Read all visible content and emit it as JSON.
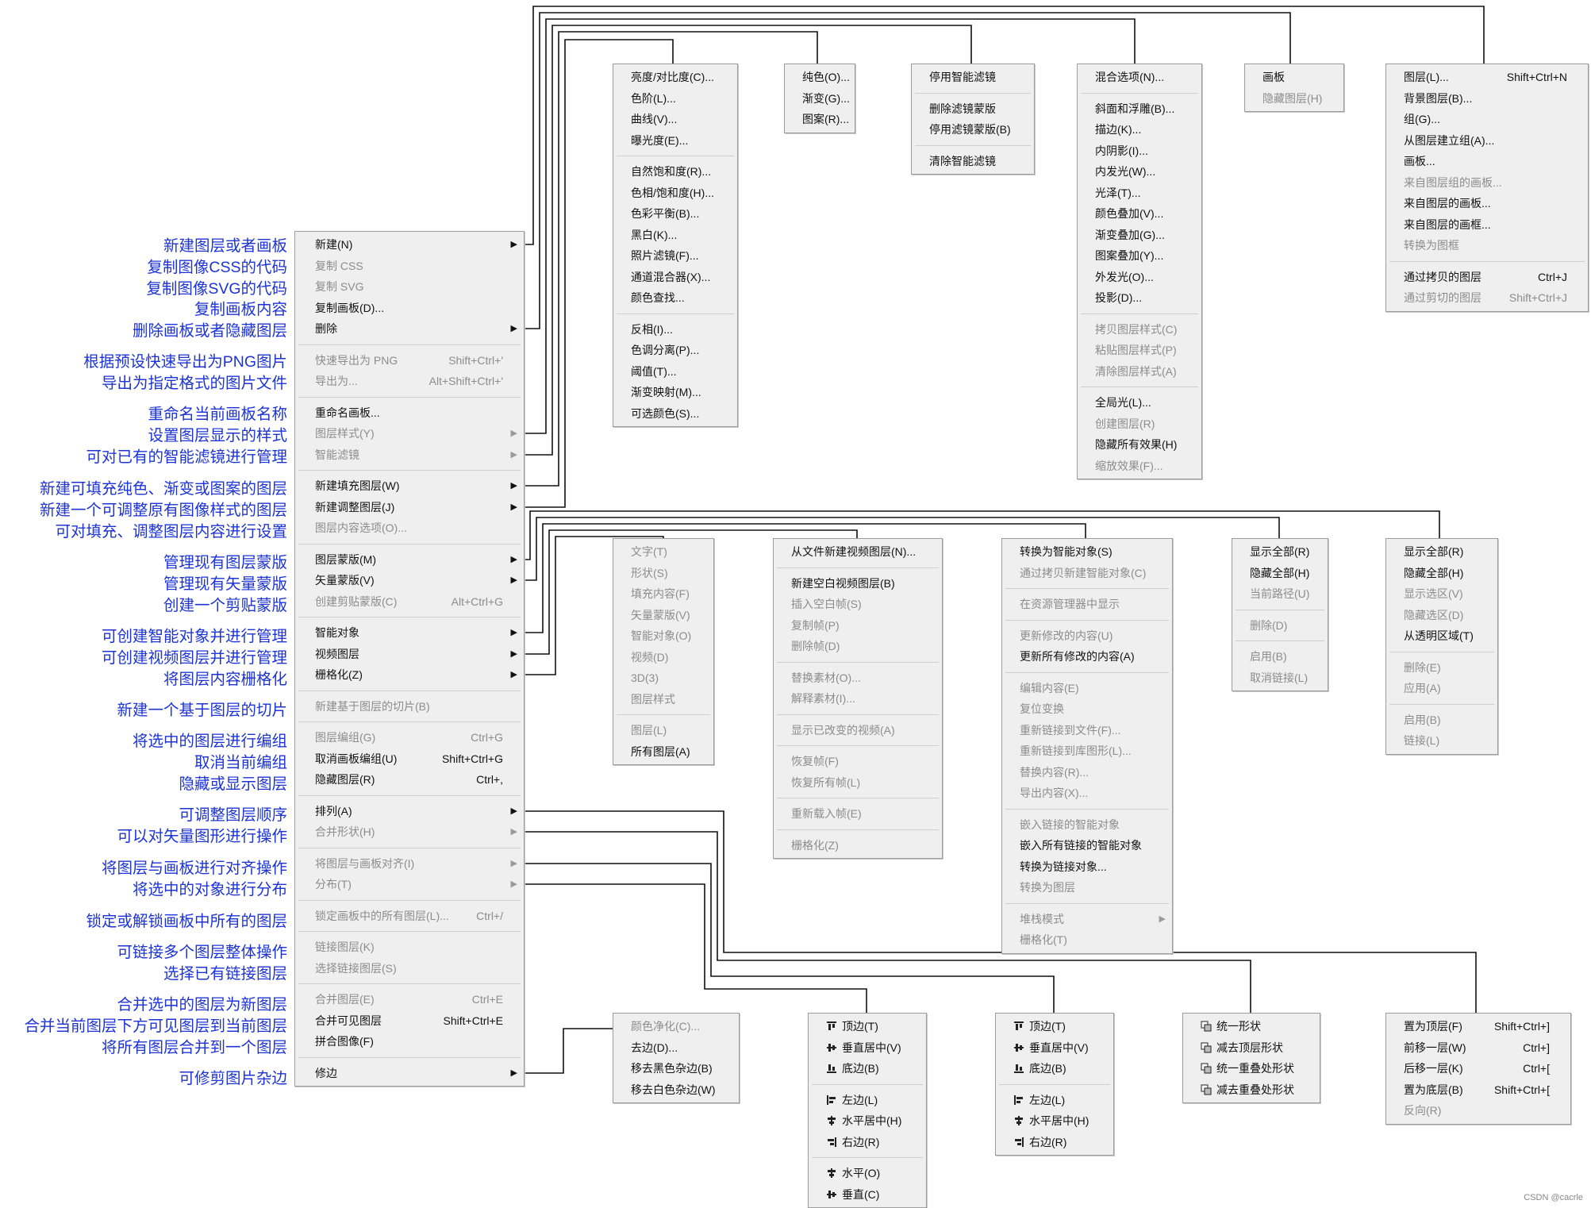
{
  "annotations": [
    "新建图层或者画板",
    "复制图像CSS的代码",
    "复制图像SVG的代码",
    "复制画板内容",
    "删除画板或者隐藏图层",
    "根据预设快速导出为PNG图片",
    "导出为指定格式的图片文件",
    "重命名当前画板名称",
    "设置图层显示的样式",
    "可对已有的智能滤镜进行管理",
    "新建可填充纯色、渐变或图案的图层",
    "新建一个可调整原有图像样式的图层",
    "可对填充、调整图层内容进行设置",
    "管理现有图层蒙版",
    "管理现有矢量蒙版",
    "创建一个剪贴蒙版",
    "可创建智能对象并进行管理",
    "可创建视频图层并进行管理",
    "将图层内容栅格化",
    "新建一个基于图层的切片",
    "将选中的图层进行编组",
    "取消当前编组",
    "隐藏或显示图层",
    "可调整图层顺序",
    "可以对矢量图形进行操作",
    "将图层与画板进行对齐操作",
    "将选中的对象进行分布",
    "锁定或解锁画板中所有的图层",
    "可链接多个图层整体操作",
    "选择已有链接图层",
    "合并选中的图层为新图层",
    "合并当前图层下方可见图层到当前图层",
    "将所有图层合并到一个图层",
    "可修剪图片杂边"
  ],
  "main_menu": [
    {
      "label": "新建(N)",
      "arrow": true
    },
    {
      "label": "复制 CSS",
      "dis": true
    },
    {
      "label": "复制 SVG",
      "dis": true
    },
    {
      "label": "复制画板(D)..."
    },
    {
      "label": "删除",
      "arrow": true
    },
    {
      "sep": true
    },
    {
      "label": "快速导出为 PNG",
      "shortcut": "Shift+Ctrl+'",
      "dis": true
    },
    {
      "label": "导出为...",
      "shortcut": "Alt+Shift+Ctrl+'",
      "dis": true
    },
    {
      "sep": true
    },
    {
      "label": "重命名画板..."
    },
    {
      "label": "图层样式(Y)",
      "arrow": true,
      "dis": true
    },
    {
      "label": "智能滤镜",
      "arrow": true,
      "dis": true
    },
    {
      "sep": true
    },
    {
      "label": "新建填充图层(W)",
      "arrow": true
    },
    {
      "label": "新建调整图层(J)",
      "arrow": true
    },
    {
      "label": "图层内容选项(O)...",
      "dis": true
    },
    {
      "sep": true
    },
    {
      "label": "图层蒙版(M)",
      "arrow": true
    },
    {
      "label": "矢量蒙版(V)",
      "arrow": true
    },
    {
      "label": "创建剪贴蒙版(C)",
      "shortcut": "Alt+Ctrl+G",
      "dis": true
    },
    {
      "sep": true
    },
    {
      "label": "智能对象",
      "arrow": true
    },
    {
      "label": "视频图层",
      "arrow": true
    },
    {
      "label": "栅格化(Z)",
      "arrow": true
    },
    {
      "sep": true
    },
    {
      "label": "新建基于图层的切片(B)",
      "dis": true
    },
    {
      "sep": true
    },
    {
      "label": "图层编组(G)",
      "shortcut": "Ctrl+G",
      "dis": true
    },
    {
      "label": "取消画板编组(U)",
      "shortcut": "Shift+Ctrl+G"
    },
    {
      "label": "隐藏图层(R)",
      "shortcut": "Ctrl+,"
    },
    {
      "sep": true
    },
    {
      "label": "排列(A)",
      "arrow": true
    },
    {
      "label": "合并形状(H)",
      "arrow": true,
      "dis": true
    },
    {
      "sep": true
    },
    {
      "label": "将图层与画板对齐(I)",
      "arrow": true,
      "dis": true
    },
    {
      "label": "分布(T)",
      "arrow": true,
      "dis": true
    },
    {
      "sep": true
    },
    {
      "label": "锁定画板中的所有图层(L)...",
      "shortcut": "Ctrl+/",
      "dis": true
    },
    {
      "sep": true
    },
    {
      "label": "链接图层(K)",
      "dis": true
    },
    {
      "label": "选择链接图层(S)",
      "dis": true
    },
    {
      "sep": true
    },
    {
      "label": "合并图层(E)",
      "shortcut": "Ctrl+E",
      "dis": true
    },
    {
      "label": "合并可见图层",
      "shortcut": "Shift+Ctrl+E"
    },
    {
      "label": "拼合图像(F)"
    },
    {
      "sep": true
    },
    {
      "label": "修边",
      "arrow": true
    }
  ],
  "submenus": {
    "adjust": [
      {
        "label": "亮度/对比度(C)..."
      },
      {
        "label": "色阶(L)..."
      },
      {
        "label": "曲线(V)..."
      },
      {
        "label": "曝光度(E)..."
      },
      {
        "sep": true
      },
      {
        "label": "自然饱和度(R)..."
      },
      {
        "label": "色相/饱和度(H)..."
      },
      {
        "label": "色彩平衡(B)..."
      },
      {
        "label": "黑白(K)..."
      },
      {
        "label": "照片滤镜(F)..."
      },
      {
        "label": "通道混合器(X)..."
      },
      {
        "label": "颜色查找..."
      },
      {
        "sep": true
      },
      {
        "label": "反相(I)..."
      },
      {
        "label": "色调分离(P)..."
      },
      {
        "label": "阈值(T)..."
      },
      {
        "label": "渐变映射(M)..."
      },
      {
        "label": "可选颜色(S)..."
      }
    ],
    "fill": [
      {
        "label": "纯色(O)..."
      },
      {
        "label": "渐变(G)..."
      },
      {
        "label": "图案(R)..."
      }
    ],
    "smartfilter": [
      {
        "label": "停用智能滤镜"
      },
      {
        "sep": true
      },
      {
        "label": "删除滤镜蒙版"
      },
      {
        "label": "停用滤镜蒙版(B)"
      },
      {
        "sep": true
      },
      {
        "label": "清除智能滤镜"
      }
    ],
    "style": [
      {
        "label": "混合选项(N)..."
      },
      {
        "sep": true
      },
      {
        "label": "斜面和浮雕(B)..."
      },
      {
        "label": "描边(K)..."
      },
      {
        "label": "内阴影(I)..."
      },
      {
        "label": "内发光(W)..."
      },
      {
        "label": "光泽(T)..."
      },
      {
        "label": "颜色叠加(V)..."
      },
      {
        "label": "渐变叠加(G)..."
      },
      {
        "label": "图案叠加(Y)..."
      },
      {
        "label": "外发光(O)..."
      },
      {
        "label": "投影(D)..."
      },
      {
        "sep": true
      },
      {
        "label": "拷贝图层样式(C)",
        "dis": true
      },
      {
        "label": "粘贴图层样式(P)",
        "dis": true
      },
      {
        "label": "清除图层样式(A)",
        "dis": true
      },
      {
        "sep": true
      },
      {
        "label": "全局光(L)..."
      },
      {
        "label": "创建图层(R)",
        "dis": true
      },
      {
        "label": "隐藏所有效果(H)"
      },
      {
        "label": "缩放效果(F)...",
        "dis": true
      }
    ],
    "delete": [
      {
        "label": "画板"
      },
      {
        "label": "隐藏图层(H)",
        "dis": true
      }
    ],
    "new": [
      {
        "label": "图层(L)...",
        "shortcut": "Shift+Ctrl+N"
      },
      {
        "label": "背景图层(B)..."
      },
      {
        "label": "组(G)..."
      },
      {
        "label": "从图层建立组(A)..."
      },
      {
        "label": "画板..."
      },
      {
        "label": "来自图层组的画板...",
        "dis": true
      },
      {
        "label": "来自图层的画板..."
      },
      {
        "label": "来自图层的画框..."
      },
      {
        "label": "转换为图框",
        "dis": true
      },
      {
        "sep": true
      },
      {
        "label": "通过拷贝的图层",
        "shortcut": "Ctrl+J"
      },
      {
        "label": "通过剪切的图层",
        "shortcut": "Shift+Ctrl+J",
        "dis": true
      }
    ],
    "raster": [
      {
        "label": "文字(T)",
        "dis": true
      },
      {
        "label": "形状(S)",
        "dis": true
      },
      {
        "label": "填充内容(F)",
        "dis": true
      },
      {
        "label": "矢量蒙版(V)",
        "dis": true
      },
      {
        "label": "智能对象(O)",
        "dis": true
      },
      {
        "label": "视频(D)",
        "dis": true
      },
      {
        "label": "3D(3)",
        "dis": true
      },
      {
        "label": "图层样式",
        "dis": true
      },
      {
        "sep": true
      },
      {
        "label": "图层(L)",
        "dis": true
      },
      {
        "label": "所有图层(A)"
      }
    ],
    "video": [
      {
        "label": "从文件新建视频图层(N)..."
      },
      {
        "sep": true
      },
      {
        "label": "新建空白视频图层(B)"
      },
      {
        "label": "插入空白帧(S)",
        "dis": true
      },
      {
        "label": "复制帧(P)",
        "dis": true
      },
      {
        "label": "删除帧(D)",
        "dis": true
      },
      {
        "sep": true
      },
      {
        "label": "替换素材(O)...",
        "dis": true
      },
      {
        "label": "解释素材(I)...",
        "dis": true
      },
      {
        "sep": true
      },
      {
        "label": "显示已改变的视频(A)",
        "dis": true
      },
      {
        "sep": true
      },
      {
        "label": "恢复帧(F)",
        "dis": true
      },
      {
        "label": "恢复所有帧(L)",
        "dis": true
      },
      {
        "sep": true
      },
      {
        "label": "重新载入帧(E)",
        "dis": true
      },
      {
        "sep": true
      },
      {
        "label": "栅格化(Z)",
        "dis": true
      }
    ],
    "smartobj": [
      {
        "label": "转换为智能对象(S)"
      },
      {
        "label": "通过拷贝新建智能对象(C)",
        "dis": true
      },
      {
        "sep": true
      },
      {
        "label": "在资源管理器中显示",
        "dis": true
      },
      {
        "sep": true
      },
      {
        "label": "更新修改的内容(U)",
        "dis": true
      },
      {
        "label": "更新所有修改的内容(A)"
      },
      {
        "sep": true
      },
      {
        "label": "编辑内容(E)",
        "dis": true
      },
      {
        "label": "复位变换",
        "dis": true
      },
      {
        "label": "重新链接到文件(F)...",
        "dis": true
      },
      {
        "label": "重新链接到库图形(L)...",
        "dis": true
      },
      {
        "label": "替换内容(R)...",
        "dis": true
      },
      {
        "label": "导出内容(X)...",
        "dis": true
      },
      {
        "sep": true
      },
      {
        "label": "嵌入链接的智能对象",
        "dis": true
      },
      {
        "label": "嵌入所有链接的智能对象"
      },
      {
        "label": "转换为链接对象..."
      },
      {
        "label": "转换为图层",
        "dis": true
      },
      {
        "sep": true
      },
      {
        "label": "堆栈模式",
        "arrow": true,
        "dis": true
      },
      {
        "label": "栅格化(T)",
        "dis": true
      }
    ],
    "vectormask": [
      {
        "label": "显示全部(R)"
      },
      {
        "label": "隐藏全部(H)"
      },
      {
        "label": "当前路径(U)",
        "dis": true
      },
      {
        "sep": true
      },
      {
        "label": "删除(D)",
        "dis": true
      },
      {
        "sep": true
      },
      {
        "label": "启用(B)",
        "dis": true
      },
      {
        "label": "取消链接(L)",
        "dis": true
      }
    ],
    "layermask": [
      {
        "label": "显示全部(R)"
      },
      {
        "label": "隐藏全部(H)"
      },
      {
        "label": "显示选区(V)",
        "dis": true
      },
      {
        "label": "隐藏选区(D)",
        "dis": true
      },
      {
        "label": "从透明区域(T)"
      },
      {
        "sep": true
      },
      {
        "label": "删除(E)",
        "dis": true
      },
      {
        "label": "应用(A)",
        "dis": true
      },
      {
        "sep": true
      },
      {
        "label": "启用(B)",
        "dis": true
      },
      {
        "label": "链接(L)",
        "dis": true
      }
    ],
    "matting": [
      {
        "label": "颜色净化(C)...",
        "dis": true
      },
      {
        "label": "去边(D)..."
      },
      {
        "label": "移去黑色杂边(B)"
      },
      {
        "label": "移去白色杂边(W)"
      }
    ],
    "distribute": [
      {
        "label": "顶边(T)",
        "icon": "dist-top-icon"
      },
      {
        "label": "垂直居中(V)",
        "icon": "dist-vcenter-icon"
      },
      {
        "label": "底边(B)",
        "icon": "dist-bottom-icon"
      },
      {
        "sep": true
      },
      {
        "label": "左边(L)",
        "icon": "dist-left-icon"
      },
      {
        "label": "水平居中(H)",
        "icon": "dist-hcenter-icon"
      },
      {
        "label": "右边(R)",
        "icon": "dist-right-icon"
      },
      {
        "sep": true
      },
      {
        "label": "水平(O)",
        "icon": "dist-horizontal-icon"
      },
      {
        "label": "垂直(C)",
        "icon": "dist-vertical-icon"
      }
    ],
    "align": [
      {
        "label": "顶边(T)",
        "icon": "align-top-icon"
      },
      {
        "label": "垂直居中(V)",
        "icon": "align-vcenter-icon"
      },
      {
        "label": "底边(B)",
        "icon": "align-bottom-icon"
      },
      {
        "sep": true
      },
      {
        "label": "左边(L)",
        "icon": "align-left-icon"
      },
      {
        "label": "水平居中(H)",
        "icon": "align-hcenter-icon"
      },
      {
        "label": "右边(R)",
        "icon": "align-right-icon"
      }
    ],
    "shapes": [
      {
        "label": "统一形状",
        "icon": "unite-shape-icon"
      },
      {
        "label": "减去顶层形状",
        "icon": "subtract-shape-icon"
      },
      {
        "label": "统一重叠处形状",
        "icon": "intersect-shape-icon"
      },
      {
        "label": "减去重叠处形状",
        "icon": "exclude-shape-icon"
      }
    ],
    "arrange": [
      {
        "label": "置为顶层(F)",
        "shortcut": "Shift+Ctrl+]"
      },
      {
        "label": "前移一层(W)",
        "shortcut": "Ctrl+]"
      },
      {
        "label": "后移一层(K)",
        "shortcut": "Ctrl+["
      },
      {
        "label": "置为底层(B)",
        "shortcut": "Shift+Ctrl+["
      },
      {
        "label": "反向(R)",
        "dis": true
      }
    ]
  },
  "watermark": "CSDN @cacrle",
  "colors": {
    "annotation": "#1c33d6",
    "menu_bg": "#efefef",
    "menu_border": "#9c9c9c",
    "disabled": "#8c8c8c"
  }
}
